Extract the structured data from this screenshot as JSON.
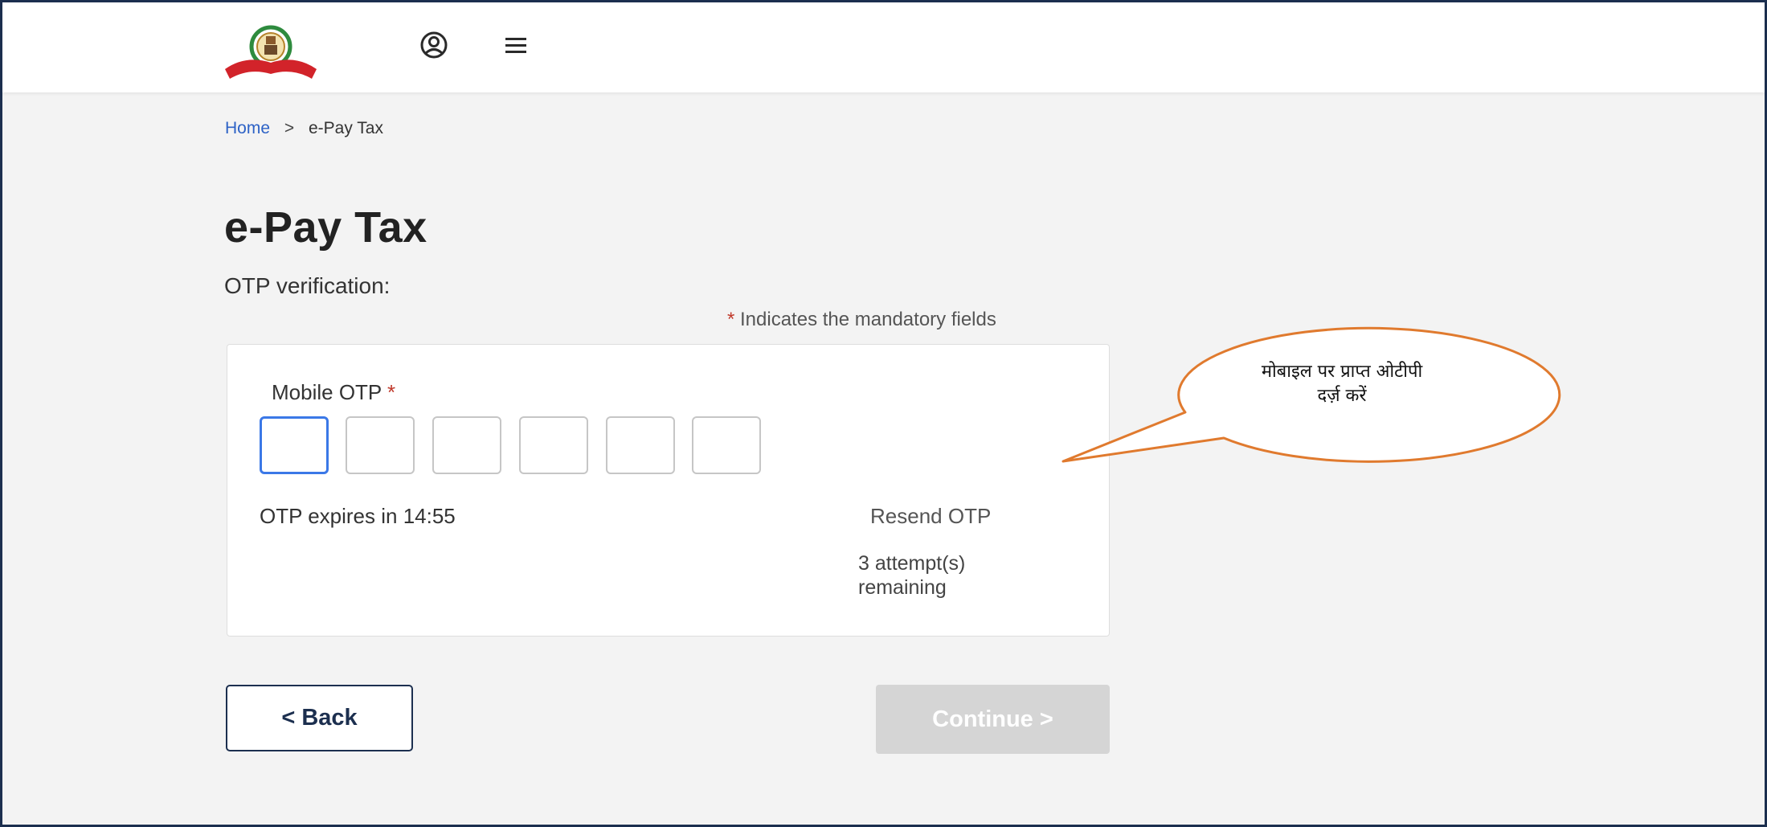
{
  "header": {
    "logo_icon": "income-tax-department-emblem-icon",
    "profile_icon": "user-circle-icon",
    "menu_icon": "hamburger-menu-icon"
  },
  "breadcrumb": {
    "home": "Home",
    "separator": ">",
    "current": "e-Pay Tax"
  },
  "page": {
    "title": "e-Pay Tax",
    "subtitle": "OTP verification:",
    "mandatory_star": "*",
    "mandatory_note": "Indicates the mandatory fields"
  },
  "otp": {
    "label": "Mobile OTP",
    "required_star": "*",
    "expires_text": "OTP expires in 14:55",
    "resend_label": "Resend OTP",
    "attempts_line1": "3 attempt(s)",
    "attempts_line2": "remaining"
  },
  "actions": {
    "back_label": "< Back",
    "continue_label": "Continue >"
  },
  "annotation": {
    "line1": "मोबाइल पर प्राप्त ओटीपी",
    "line2": "दर्ज़ करें"
  },
  "colors": {
    "accent": "#3b78e7",
    "navy": "#1c2f4f",
    "callout_stroke": "#e07a2e",
    "disabled": "#d5d5d5"
  }
}
